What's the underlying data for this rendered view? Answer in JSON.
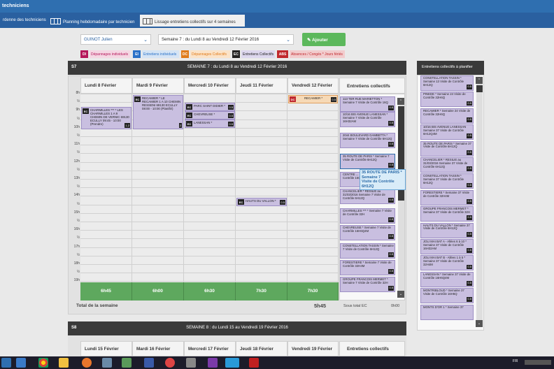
{
  "header": {
    "title": "techniciens"
  },
  "tabs": [
    {
      "label": "rdenne des techniciens"
    },
    {
      "label": "Planning hebdomadaire par technicien"
    },
    {
      "label": "Lissage entretiens collectifs sur 4 semaines"
    }
  ],
  "filters": {
    "technician": "GUINOT Julien",
    "week": "Semaine 7 : du Lundi 8 au Vendredi 12 Février 2016",
    "add_button": "Ajouter"
  },
  "legend": [
    {
      "code": "DI",
      "label": "Dépannages individuels",
      "color": "#b5175a"
    },
    {
      "code": "EI",
      "label": "Entretiens individuels",
      "color": "#2a72c8"
    },
    {
      "code": "DC",
      "label": "Dépannages Collectifs",
      "color": "#e07b1a"
    },
    {
      "code": "EC",
      "label": "Entretiens Collectifs",
      "color": "#222222"
    },
    {
      "code": "ABS",
      "label": "Absences / Congés * Jours fériés",
      "color": "#c0282d"
    }
  ],
  "week7": {
    "num": "S7",
    "title": "SEMAINE 7 : du Lundi 8 au Vendredi 12 Février 2016",
    "total_label": "Total de la semaine",
    "total": "5h45",
    "subtotal_label": "Sous total EC",
    "subtotal": "0h00"
  },
  "days": [
    {
      "label": "Lundi 8 Février",
      "total": "6h45"
    },
    {
      "label": "Mardi 9 Février",
      "total": "6h00"
    },
    {
      "label": "Mercredi 10 Février",
      "total": "6h30"
    },
    {
      "label": "Jeudi 11 Février",
      "total": "7h30"
    },
    {
      "label": "Vendredi 12 Février",
      "total": "7h30"
    }
  ],
  "hours": [
    "8h",
    "½",
    "9h",
    "½",
    "10h",
    "½",
    "11h",
    "½",
    "12h",
    "½",
    "13h",
    "½",
    "14h",
    "½",
    "15h",
    "½",
    "16h",
    "½",
    "17h",
    "½",
    "18h",
    "½",
    "19h"
  ],
  "appointments": [
    {
      "tag": "EC",
      "text": "CHARMILLES *** * LES CHARMILLES 1 A 9 CHEMIN DE VERNIC 69130 ECULLY 09:45 - 10:00 (Prendre)",
      "dur": "1.2"
    },
    {
      "tag": "EC",
      "text": "RECAMIER * LE RECAMIER 1 A 10 CHEMIN RESSENI 69130 ECULLY 08:00 - 10:00 (Planifié)",
      "dur": "2"
    },
    {
      "tag": "EC",
      "text": "PARC SAINT DIDIER *",
      "dur": "0.5"
    },
    {
      "tag": "EC",
      "text": "CHEVREUSE *",
      "dur": "0.5"
    },
    {
      "tag": "EC",
      "text": "LANESSAN *",
      "dur": "0.5"
    },
    {
      "tag": "EC",
      "text": "HAUTS DU VALLON *",
      "dur": "0.5"
    },
    {
      "tag": "DC",
      "text": "RECAMIER *",
      "dur": "0.5"
    }
  ],
  "ec_panel": {
    "title": "Entretiens collectifs",
    "items": [
      {
        "text": "113 TER RUE MARIETTON * Semaine 7 Visite de Contrôle 16Q",
        "dur": "0.5"
      },
      {
        "text": "10/16 BIS AVENUE LANESSAN * Semaine 7 Visite de Contrôle 16H32AM",
        "dur": "0.5"
      },
      {
        "text": "2044 BOULEVARD GAMBETTA * Semaine 7 Visite de Contrôle 6H12Q",
        "dur": "0.5"
      },
      {
        "text": "35 ROUTE DE PARIS * Semaine 7 Visite de Contrôle 6H12Q",
        "dur": "0.5"
      },
      {
        "text": "CENTRE ... Semaine 7 Visite de Contrôle 16Q",
        "dur": "0.5"
      },
      {
        "text": "CHANCELIER * RESILIE au 31/03/2016 Semaine 7 Visite de Contrôle 6H12Q",
        "dur": "0.5"
      },
      {
        "text": "CHARMILLES *** * Semaine 7 Visite de Contrôle 32H",
        "dur": "0.5"
      },
      {
        "text": "CHEVREUSE * Semaine 7 Visite de Contrôle 16H6Q4M",
        "dur": "0.5"
      },
      {
        "text": "CONSTELLATION TASSIN * Semaine 7 Visite de Contrôle 6H12Q",
        "dur": "0.5"
      },
      {
        "text": "FORESTIERE * Semaine 7 Visite de Contrôle 32H4M",
        "dur": "0.5"
      },
      {
        "text": "GROUPE FRANCOIS MERMET * Semaine 7 Visite de Contrôle 32H",
        "dur": "0.5"
      }
    ],
    "tooltip": [
      "35 ROUTE DE PARIS *",
      "Semaine 7",
      "Visite de Contrôle",
      "6H12Q"
    ]
  },
  "right_panel": {
    "title": "Entretiens collectifs à planifier",
    "items": [
      {
        "text": "CONSTELLATION TASSIN * Semaine 13 Visite de Contrôle 6H12Q",
        "dur": "0.5"
      },
      {
        "text": "PINEDE * Semaine 24 Visite de Contrôle 32H6Q",
        "dur": "0.5"
      },
      {
        "text": "RECAMIER * Semaine 24 Visite de Contrôle 32H6Q",
        "dur": "0.5"
      },
      {
        "text": "10/16 BIS AVENUE LANESSAN Semaine 37 Visite de Contrôle 6H12Q4M",
        "dur": "0.5"
      },
      {
        "text": "35 ROUTE DE PARIS * Semaine 37 Visite de Contrôle 6H12Q",
        "dur": "0.5"
      },
      {
        "text": "CHANCELIER * RESILIE au 31/03/2016 Semaine 37 Visite de Contrôle 6H12Q",
        "dur": "0.5"
      },
      {
        "text": "CONSTELLATION TASSIN * Semaine 37 Visite de Contrôle 6H12Q",
        "dur": "0.5"
      },
      {
        "text": "FORESTIERE * Semaine 37 Visite de Contrôle 32H4M",
        "dur": "0.5"
      },
      {
        "text": "GROUPE FRANCOIS MERMET * Semaine 37 Visite de Contrôle 32H",
        "dur": "0.5"
      },
      {
        "text": "HAUTS DU VALLON * Semaine 37 Visite de Contrôle 6H12Q",
        "dur": "0.5"
      },
      {
        "text": "JOLI MAI BAT A - Allées 6 à 10 * Semaine 37 Visite de Contrôle 16H32AM",
        "dur": "0.5"
      },
      {
        "text": "JOLI MAI BAT B - Allées 1 à 5 * Semaine 37 Visite de Contrôle 32H4M",
        "dur": "0.5"
      },
      {
        "text": "LANESSAN * Semaine 37 Visite de Contrôle 16H6Q4M",
        "dur": "0.5"
      },
      {
        "text": "MONTRIBLOUD * Semaine 37 Visite de Contrôle 16H6Q",
        "dur": "0.5"
      },
      {
        "text": "MONTS D'OR 1 * Semaine 37",
        "dur": ""
      }
    ]
  },
  "week8": {
    "num": "S8",
    "title": "SEMAINE 8 : du Lundi 15 au Vendredi 19 Février 2016",
    "days": [
      "Lundi 15 Février",
      "Mardi 16 Février",
      "Mercredi 17 Février",
      "Jeudi 18 Février",
      "Vendredi 19 Février"
    ],
    "ec_title": "Entretiens collectifs"
  },
  "system_tray": {
    "lang": "FR"
  }
}
